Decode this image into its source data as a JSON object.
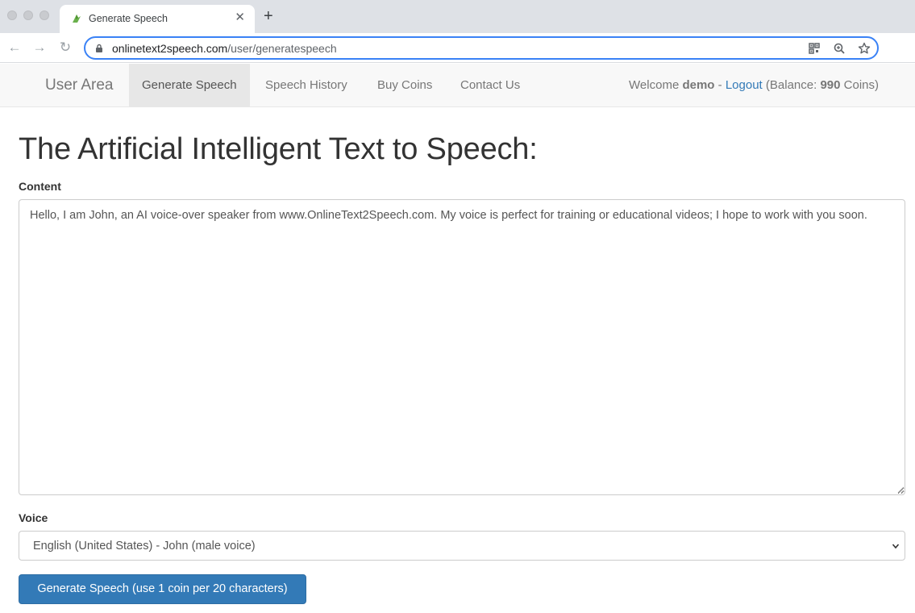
{
  "browser": {
    "tab_title": "Generate Speech",
    "close_glyph": "✕",
    "new_tab_glyph": "+",
    "url_host": "onlinetext2speech.com",
    "url_path": "/user/generatespeech",
    "back_glyph": "←",
    "forward_glyph": "→",
    "reload_glyph": "↻",
    "icons": [
      "back-icon",
      "forward-icon",
      "reload-icon",
      "lock-icon",
      "qr-code-icon",
      "zoom-icon",
      "star-icon"
    ]
  },
  "navbar": {
    "brand": "User Area",
    "links": [
      "Generate Speech",
      "Speech History",
      "Buy Coins",
      "Contact Us"
    ],
    "active_link": "Generate Speech",
    "welcome_prefix": "Welcome",
    "username": "demo",
    "separator": "-",
    "logout": "Logout",
    "balance_prefix": "(Balance:",
    "balance_value": "990",
    "balance_suffix": "Coins)"
  },
  "main": {
    "title": "The Artificial Intelligent Text to Speech:",
    "content_label": "Content",
    "content_text": "Hello, I am John, an AI voice-over speaker from www.OnlineText2Speech.com. My voice is perfect for training or educational videos; I hope to work with you soon.",
    "voice_label": "Voice",
    "voice_selected": "English (United States) - John (male voice)",
    "generate_button": "Generate Speech (use 1 coin per 20 characters)"
  },
  "colors": {
    "primary": "#337ab7",
    "link": "#337ab7",
    "omnibox_focus": "#3a82f6"
  }
}
